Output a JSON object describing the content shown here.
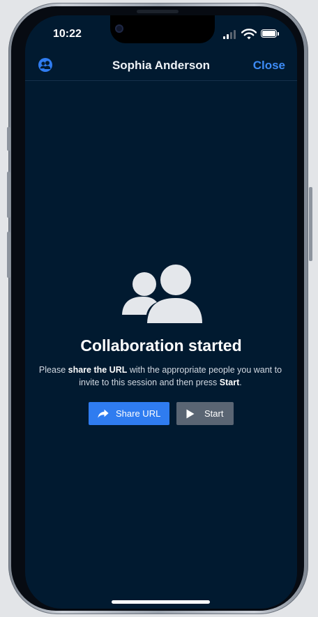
{
  "status_bar": {
    "time": "10:22",
    "icons": [
      "signal-icon",
      "wifi-icon",
      "battery-icon"
    ]
  },
  "header": {
    "left_icon": "collaboration-icon",
    "title": "Sophia Anderson",
    "close_label": "Close"
  },
  "main": {
    "icon": "people-icon",
    "heading": "Collaboration started",
    "message": {
      "part1": "Please ",
      "bold1": "share the URL",
      "part2": " with the appropriate people you want to invite to this session and then press ",
      "bold2": "Start",
      "part3": "."
    },
    "buttons": {
      "share": {
        "label": "Share URL",
        "icon": "share-arrow-icon"
      },
      "start": {
        "label": "Start",
        "icon": "play-icon"
      }
    }
  },
  "colors": {
    "background": "#011a30",
    "accent": "#2f7cf0",
    "close": "#3d8bf5",
    "secondary_button": "#5a6573"
  }
}
